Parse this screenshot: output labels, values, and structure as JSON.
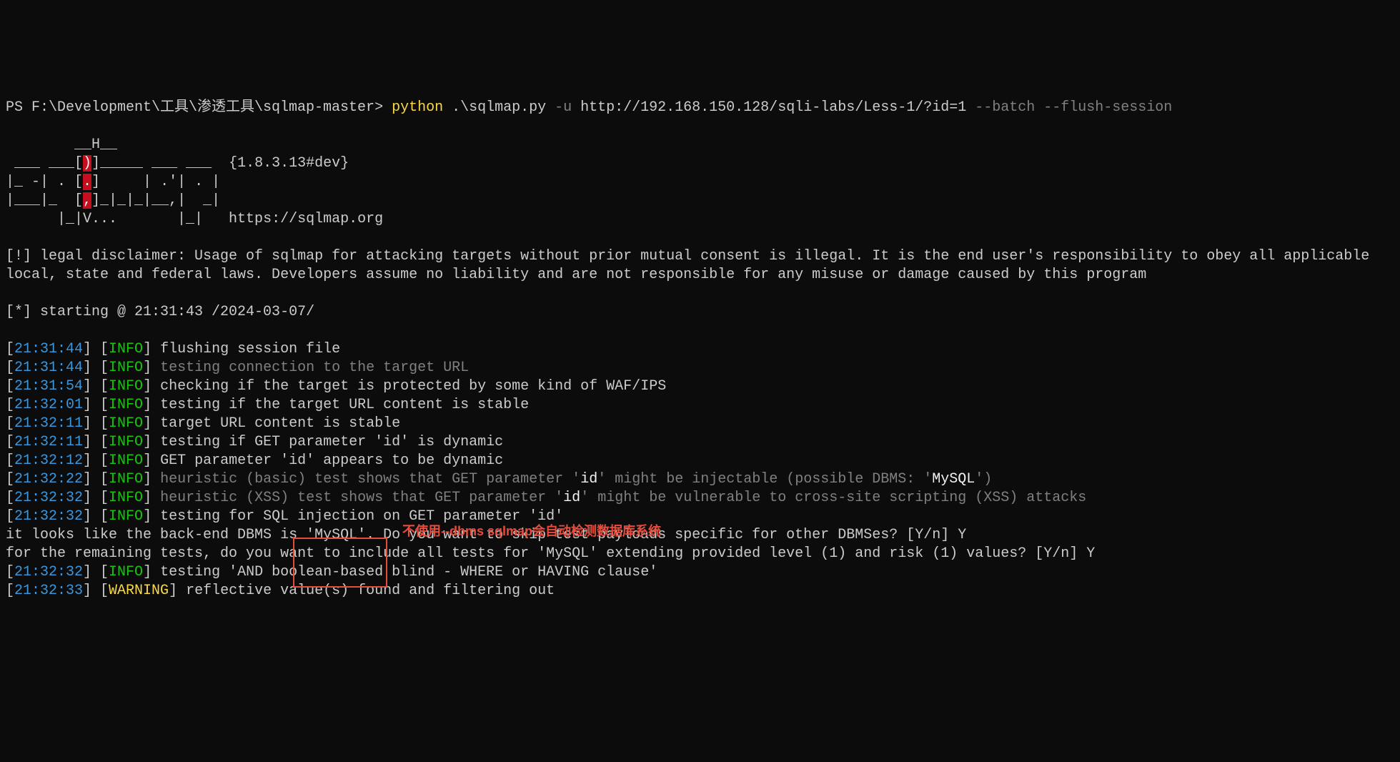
{
  "prompt": {
    "path": "PS F:\\Development\\工具\\渗透工具\\sqlmap-master> ",
    "python": "python",
    "script": " .\\sqlmap.py ",
    "flag_u": "-u",
    "url": " http://192.168.150.128/sqli-labs/Less-1/?id=1 ",
    "flag_batch": "--batch",
    "flag_flush": " --flush-session"
  },
  "logo": {
    "line1": "        __H__",
    "line2a": " ___ ___[",
    "line2b": ")",
    "line2c": "]_____ ___ ___  ",
    "line2d": "{1.8.3.13#dev}",
    "line3a": "|_ -| . [",
    "line3b": ".",
    "line3c": "]     | .'| . |",
    "line4a": "|___|_  [",
    "line4b": ",",
    "line4c": "]_|_|_|__,|  _|",
    "line5": "      |_|V...       |_|   https://sqlmap.org"
  },
  "disclaimer": "[!] legal disclaimer: Usage of sqlmap for attacking targets without prior mutual consent is illegal. It is the end user's responsibility to obey all applicable local, state and federal laws. Developers assume no liability and are not responsible for any misuse or damage caused by this program",
  "starting": "[*] starting @ 21:31:43 /2024-03-07/",
  "logs": [
    {
      "time": "21:31:44",
      "level": "INFO",
      "msg": "flushing session file",
      "style": "white"
    },
    {
      "time": "21:31:44",
      "level": "INFO",
      "msg": "testing connection to the target URL",
      "style": "gray"
    },
    {
      "time": "21:31:54",
      "level": "INFO",
      "msg": "checking if the target is protected by some kind of WAF/IPS",
      "style": "white"
    },
    {
      "time": "21:32:01",
      "level": "INFO",
      "msg": "testing if the target URL content is stable",
      "style": "white"
    },
    {
      "time": "21:32:11",
      "level": "INFO",
      "msg": "target URL content is stable",
      "style": "white"
    },
    {
      "time": "21:32:11",
      "level": "INFO",
      "msg": "testing if GET parameter 'id' is dynamic",
      "style": "white"
    },
    {
      "time": "21:32:12",
      "level": "INFO",
      "msg": "GET parameter 'id' appears to be dynamic",
      "style": "white"
    }
  ],
  "heuristic1": {
    "time": "21:32:22",
    "level": "INFO",
    "pre": "heuristic (basic) test shows that GET parameter '",
    "param": "id",
    "mid": "' might be injectable (possible DBMS: '",
    "dbms": "MySQL",
    "post": "')"
  },
  "heuristic2": {
    "time": "21:32:32",
    "level": "INFO",
    "pre": "heuristic (XSS) test shows that GET parameter '",
    "param": "id",
    "post": "' might be vulnerable to cross-site scripting (XSS) attacks"
  },
  "injection_test": {
    "time": "21:32:32",
    "level": "INFO",
    "msg": "testing for SQL injection on GET parameter 'id'"
  },
  "question1": "it looks like the back-end DBMS is 'MySQL'. Do you want to skip test payloads specific for other DBMSes? [Y/n] Y",
  "question2": "for the remaining tests, do you want to include all tests for 'MySQL' extending provided level (1) and risk (1) values? [Y/n] Y",
  "test_bool": {
    "time": "21:32:32",
    "level": "INFO",
    "msg": "testing 'AND boolean-based blind - WHERE or HAVING clause'"
  },
  "warn_reflect": {
    "time": "21:32:33",
    "level": "WARNING",
    "msg": "reflective value(s) found and filtering out"
  },
  "annotation": "不使用--dbms sqlmap会自动检测数据库系统"
}
